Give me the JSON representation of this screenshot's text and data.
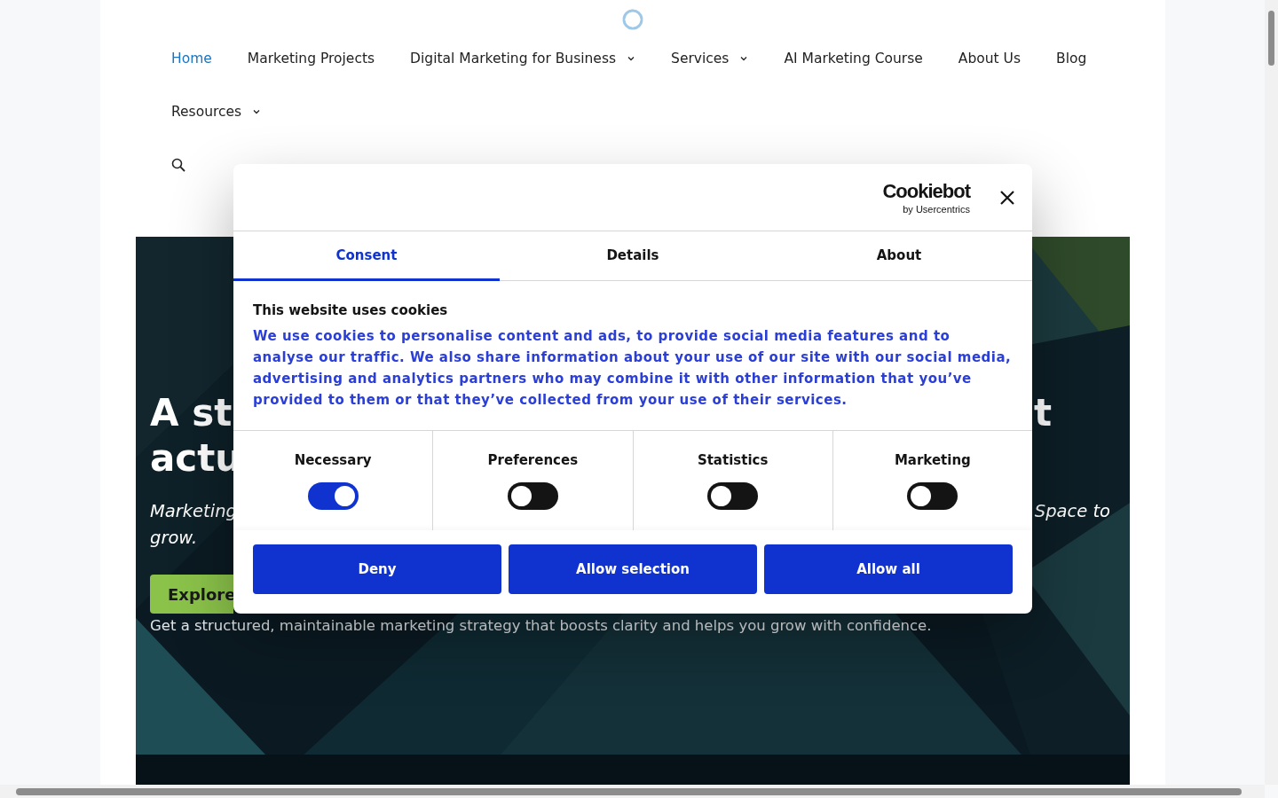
{
  "nav": {
    "items": [
      {
        "label": "Home",
        "selected": true,
        "dropdown": false
      },
      {
        "label": "Marketing Projects",
        "selected": false,
        "dropdown": false
      },
      {
        "label": "Digital Marketing for Business",
        "selected": false,
        "dropdown": true
      },
      {
        "label": "Services",
        "selected": false,
        "dropdown": true
      },
      {
        "label": "AI Marketing Course",
        "selected": false,
        "dropdown": false
      },
      {
        "label": "About Us",
        "selected": false,
        "dropdown": false
      },
      {
        "label": "Blog",
        "selected": false,
        "dropdown": false
      },
      {
        "label": "Resources",
        "selected": false,
        "dropdown": true
      }
    ]
  },
  "hero": {
    "heading": {
      "line_1_left": "A st",
      "line_1_right": "t",
      "line_2": "actu"
    },
    "subtitle": {
      "line_1_left": "Marketing",
      "line_1_right": "Space to",
      "line_2": "grow."
    },
    "button": "Explore",
    "tagline": "Get a structured, maintainable marketing strategy that boosts clarity and helps you grow with confidence."
  },
  "dialog": {
    "brand": "Cookiebot",
    "brand_sub": "by Usercentrics",
    "tabs": [
      {
        "label": "Consent",
        "selected": true
      },
      {
        "label": "Details",
        "selected": false
      },
      {
        "label": "About",
        "selected": false
      }
    ],
    "title": "This website uses cookies",
    "text": "We use cookies to personalise content and ads, to provide social media features and to analyse our traffic. We also share information about your use of our site with our social media, advertising and analytics partners who may combine it with other information that you’ve provided to them or that they’ve collected from your use of their services.",
    "categories": [
      {
        "label": "Necessary",
        "on": true
      },
      {
        "label": "Preferences",
        "on": false
      },
      {
        "label": "Statistics",
        "on": false
      },
      {
        "label": "Marketing",
        "on": false
      }
    ],
    "buttons": [
      "Deny",
      "Allow selection",
      "Allow all"
    ]
  }
}
